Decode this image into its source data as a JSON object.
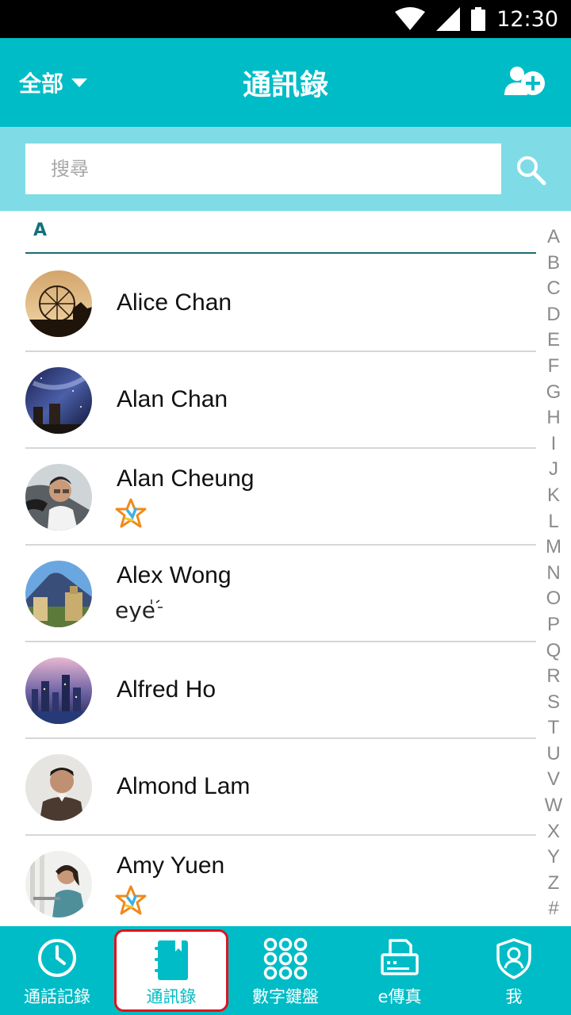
{
  "status": {
    "time": "12:30"
  },
  "header": {
    "filter_label": "全部",
    "title": "通訊錄"
  },
  "search": {
    "placeholder": "搜尋"
  },
  "section": {
    "letter": "A"
  },
  "contacts": [
    {
      "name": "Alice Chan",
      "badge": ""
    },
    {
      "name": "Alan Chan",
      "badge": ""
    },
    {
      "name": "Alan Cheung",
      "badge": "star-icon"
    },
    {
      "name": "Alex Wong",
      "badge": "eye-logo"
    },
    {
      "name": "Alfred Ho",
      "badge": ""
    },
    {
      "name": "Almond Lam",
      "badge": ""
    },
    {
      "name": "Amy Yuen",
      "badge": "star-icon"
    }
  ],
  "alpha_index": [
    "A",
    "B",
    "C",
    "D",
    "E",
    "F",
    "G",
    "H",
    "I",
    "J",
    "K",
    "L",
    "M",
    "N",
    "O",
    "P",
    "Q",
    "R",
    "S",
    "T",
    "U",
    "V",
    "W",
    "X",
    "Y",
    "Z",
    "#"
  ],
  "nav": [
    {
      "label": "通話記錄",
      "icon": "clock-icon"
    },
    {
      "label": "通訊錄",
      "icon": "address-book-icon"
    },
    {
      "label": "數字鍵盤",
      "icon": "dialpad-icon"
    },
    {
      "label": "e傳真",
      "icon": "fax-icon"
    },
    {
      "label": "我",
      "icon": "profile-shield-icon"
    }
  ],
  "colors": {
    "primary": "#00bcc6",
    "search_band": "#7fdce6",
    "active_outline": "#e0131e"
  }
}
